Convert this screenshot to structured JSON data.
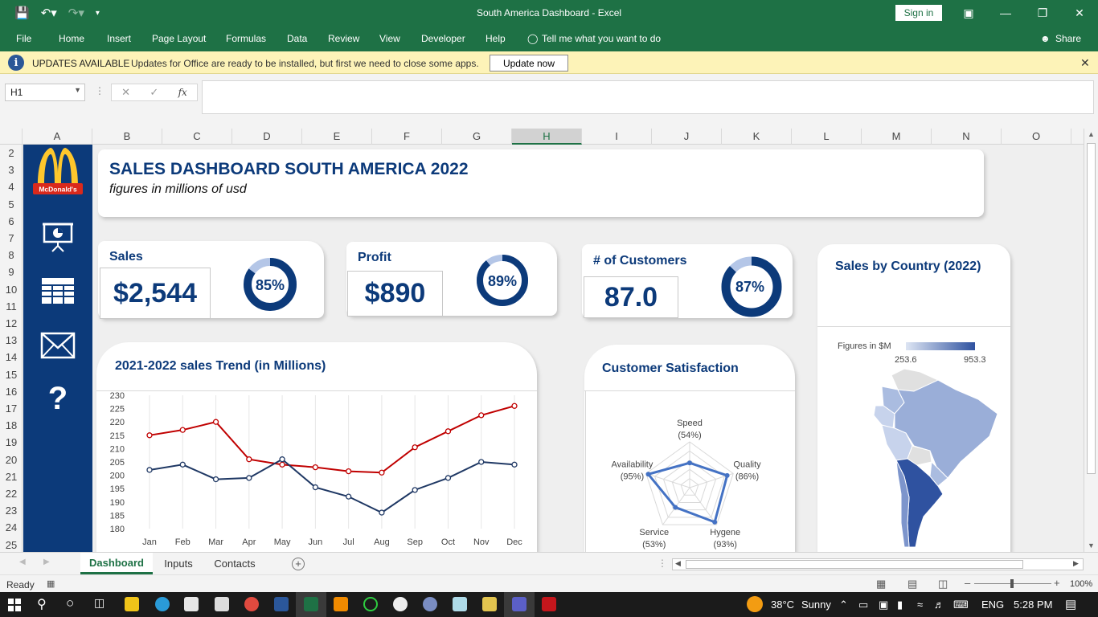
{
  "window": {
    "title": "South America Dashboard  -  Excel",
    "signin_label": "Sign in",
    "share_label": "Share"
  },
  "ribbon": {
    "tabs": [
      "File",
      "Home",
      "Insert",
      "Page Layout",
      "Formulas",
      "Data",
      "Review",
      "View",
      "Developer",
      "Help"
    ],
    "tell_me": "Tell me what you want to do"
  },
  "update_bar": {
    "title": "UPDATES AVAILABLE",
    "message": "Updates for Office are ready to be installed, but first we need to close some apps.",
    "button": "Update now"
  },
  "formula_bar": {
    "name_box": "H1",
    "fx_label": "fx",
    "formula": ""
  },
  "columns": [
    "A",
    "B",
    "C",
    "D",
    "E",
    "F",
    "G",
    "H",
    "I",
    "J",
    "K",
    "L",
    "M",
    "N",
    "O"
  ],
  "selected_column": "H",
  "rows": [
    "2",
    "3",
    "4",
    "5",
    "6",
    "7",
    "8",
    "9",
    "10",
    "11",
    "12",
    "13",
    "14",
    "15",
    "16",
    "17",
    "18",
    "19",
    "20",
    "21",
    "22",
    "23",
    "24",
    "25"
  ],
  "logo": {
    "text": "McDonald's",
    "arch_color": "#ffc72c",
    "band_color": "#da291c"
  },
  "nav_icons": [
    "presentation-icon",
    "table-icon",
    "mail-icon",
    "help-icon"
  ],
  "dashboard": {
    "title": "SALES DASHBOARD SOUTH AMERICA 2022",
    "subtitle": "figures in millions of usd",
    "accent_color": "#0c3a7a",
    "kpis": {
      "sales": {
        "label": "Sales",
        "value": "$2,544",
        "percent_text": "85%",
        "percent": 0.85
      },
      "profit": {
        "label": "Profit",
        "value": "$890",
        "percent_text": "89%",
        "percent": 0.89
      },
      "customers": {
        "label": "# of Customers",
        "value": "87.0",
        "percent_text": "87%",
        "percent": 0.87
      }
    },
    "map_card": {
      "title": "Sales by Country (2022)",
      "legend_label": "Figures in $M",
      "min_label": "253.6",
      "max_label": "953.3"
    },
    "trend_card": {
      "title": "2021-2022 sales Trend (in Millions)"
    },
    "satisfaction_card": {
      "title": "Customer Satisfaction"
    }
  },
  "chart_data": [
    {
      "type": "line",
      "title": "2021-2022 sales Trend (in Millions)",
      "categories": [
        "Jan",
        "Feb",
        "Mar",
        "Apr",
        "May",
        "Jun",
        "Jul",
        "Aug",
        "Sep",
        "Oct",
        "Nov",
        "Dec"
      ],
      "y_ticks": [
        "180",
        "185",
        "190",
        "195",
        "200",
        "205",
        "210",
        "215",
        "220",
        "225",
        "230"
      ],
      "ylim": [
        180,
        230
      ],
      "series": [
        {
          "color": "#c00000",
          "values": [
            215,
            217,
            220,
            206,
            204,
            203,
            201.5,
            201,
            210.5,
            216.5,
            222.5,
            226
          ]
        },
        {
          "color": "#1f3864",
          "values": [
            202,
            204,
            198.5,
            199,
            206,
            195.5,
            192,
            186,
            194.5,
            199,
            205,
            204
          ]
        }
      ]
    },
    {
      "type": "radar",
      "title": "Customer Satisfaction",
      "axes": [
        {
          "label": "Speed",
          "value_label": "(54%)",
          "value": 54
        },
        {
          "label": "Quality",
          "value_label": "(86%)",
          "value": 86
        },
        {
          "label": "Hygene",
          "value_label": "(93%)",
          "value": 93
        },
        {
          "label": "Service",
          "value_label": "(53%)",
          "value": 53
        },
        {
          "label": "Availability",
          "value_label": "(95%)",
          "value": 95
        }
      ],
      "color": "#4472c4"
    }
  ],
  "sheet_tabs": [
    "Dashboard",
    "Inputs",
    "Contacts"
  ],
  "active_sheet": "Dashboard",
  "status": {
    "ready": "Ready",
    "zoom": "100%"
  },
  "taskbar": {
    "temperature": "38°C",
    "weather": "Sunny",
    "language": "ENG",
    "time": "5:28 PM"
  }
}
